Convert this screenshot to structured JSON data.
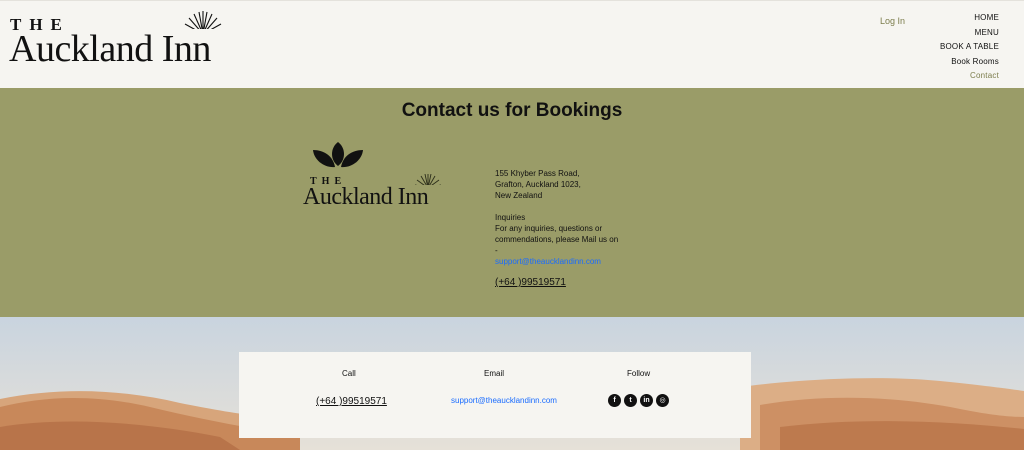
{
  "header": {
    "logo_the": "THE",
    "logo_name": "Auckland Inn",
    "login": "Log In",
    "nav": [
      "HOME",
      "MENU",
      "BOOK A TABLE",
      "Book Rooms",
      "Contact"
    ],
    "active_nav": "Contact"
  },
  "contact": {
    "title": "Contact us for Bookings",
    "logo_the": "THE",
    "logo_name": "Auckland Inn",
    "address": [
      "155 Khyber Pass Road,",
      "Grafton, Auckland 1023,",
      "New Zealand"
    ],
    "inquiries_heading": "Inquiries",
    "inquiries_text": "For any inquiries, questions or commendations, please Mail us on -",
    "email": "support@theaucklandinn.com",
    "phone": "(+64 )99519571"
  },
  "card": {
    "call_label": "Call",
    "email_label": "Email",
    "follow_label": "Follow",
    "phone": "(+64 )99519571",
    "email": "support@theaucklandinn.com",
    "socials": [
      {
        "icon": "facebook-icon",
        "glyph": "f"
      },
      {
        "icon": "twitter-icon",
        "glyph": "t"
      },
      {
        "icon": "linkedin-icon",
        "glyph": "in"
      },
      {
        "icon": "instagram-icon",
        "glyph": "◎"
      }
    ]
  },
  "colors": {
    "band": "#9a9c68",
    "accent": "#7c7d4c",
    "link": "#1a6cff",
    "background": "#f6f5f1"
  }
}
